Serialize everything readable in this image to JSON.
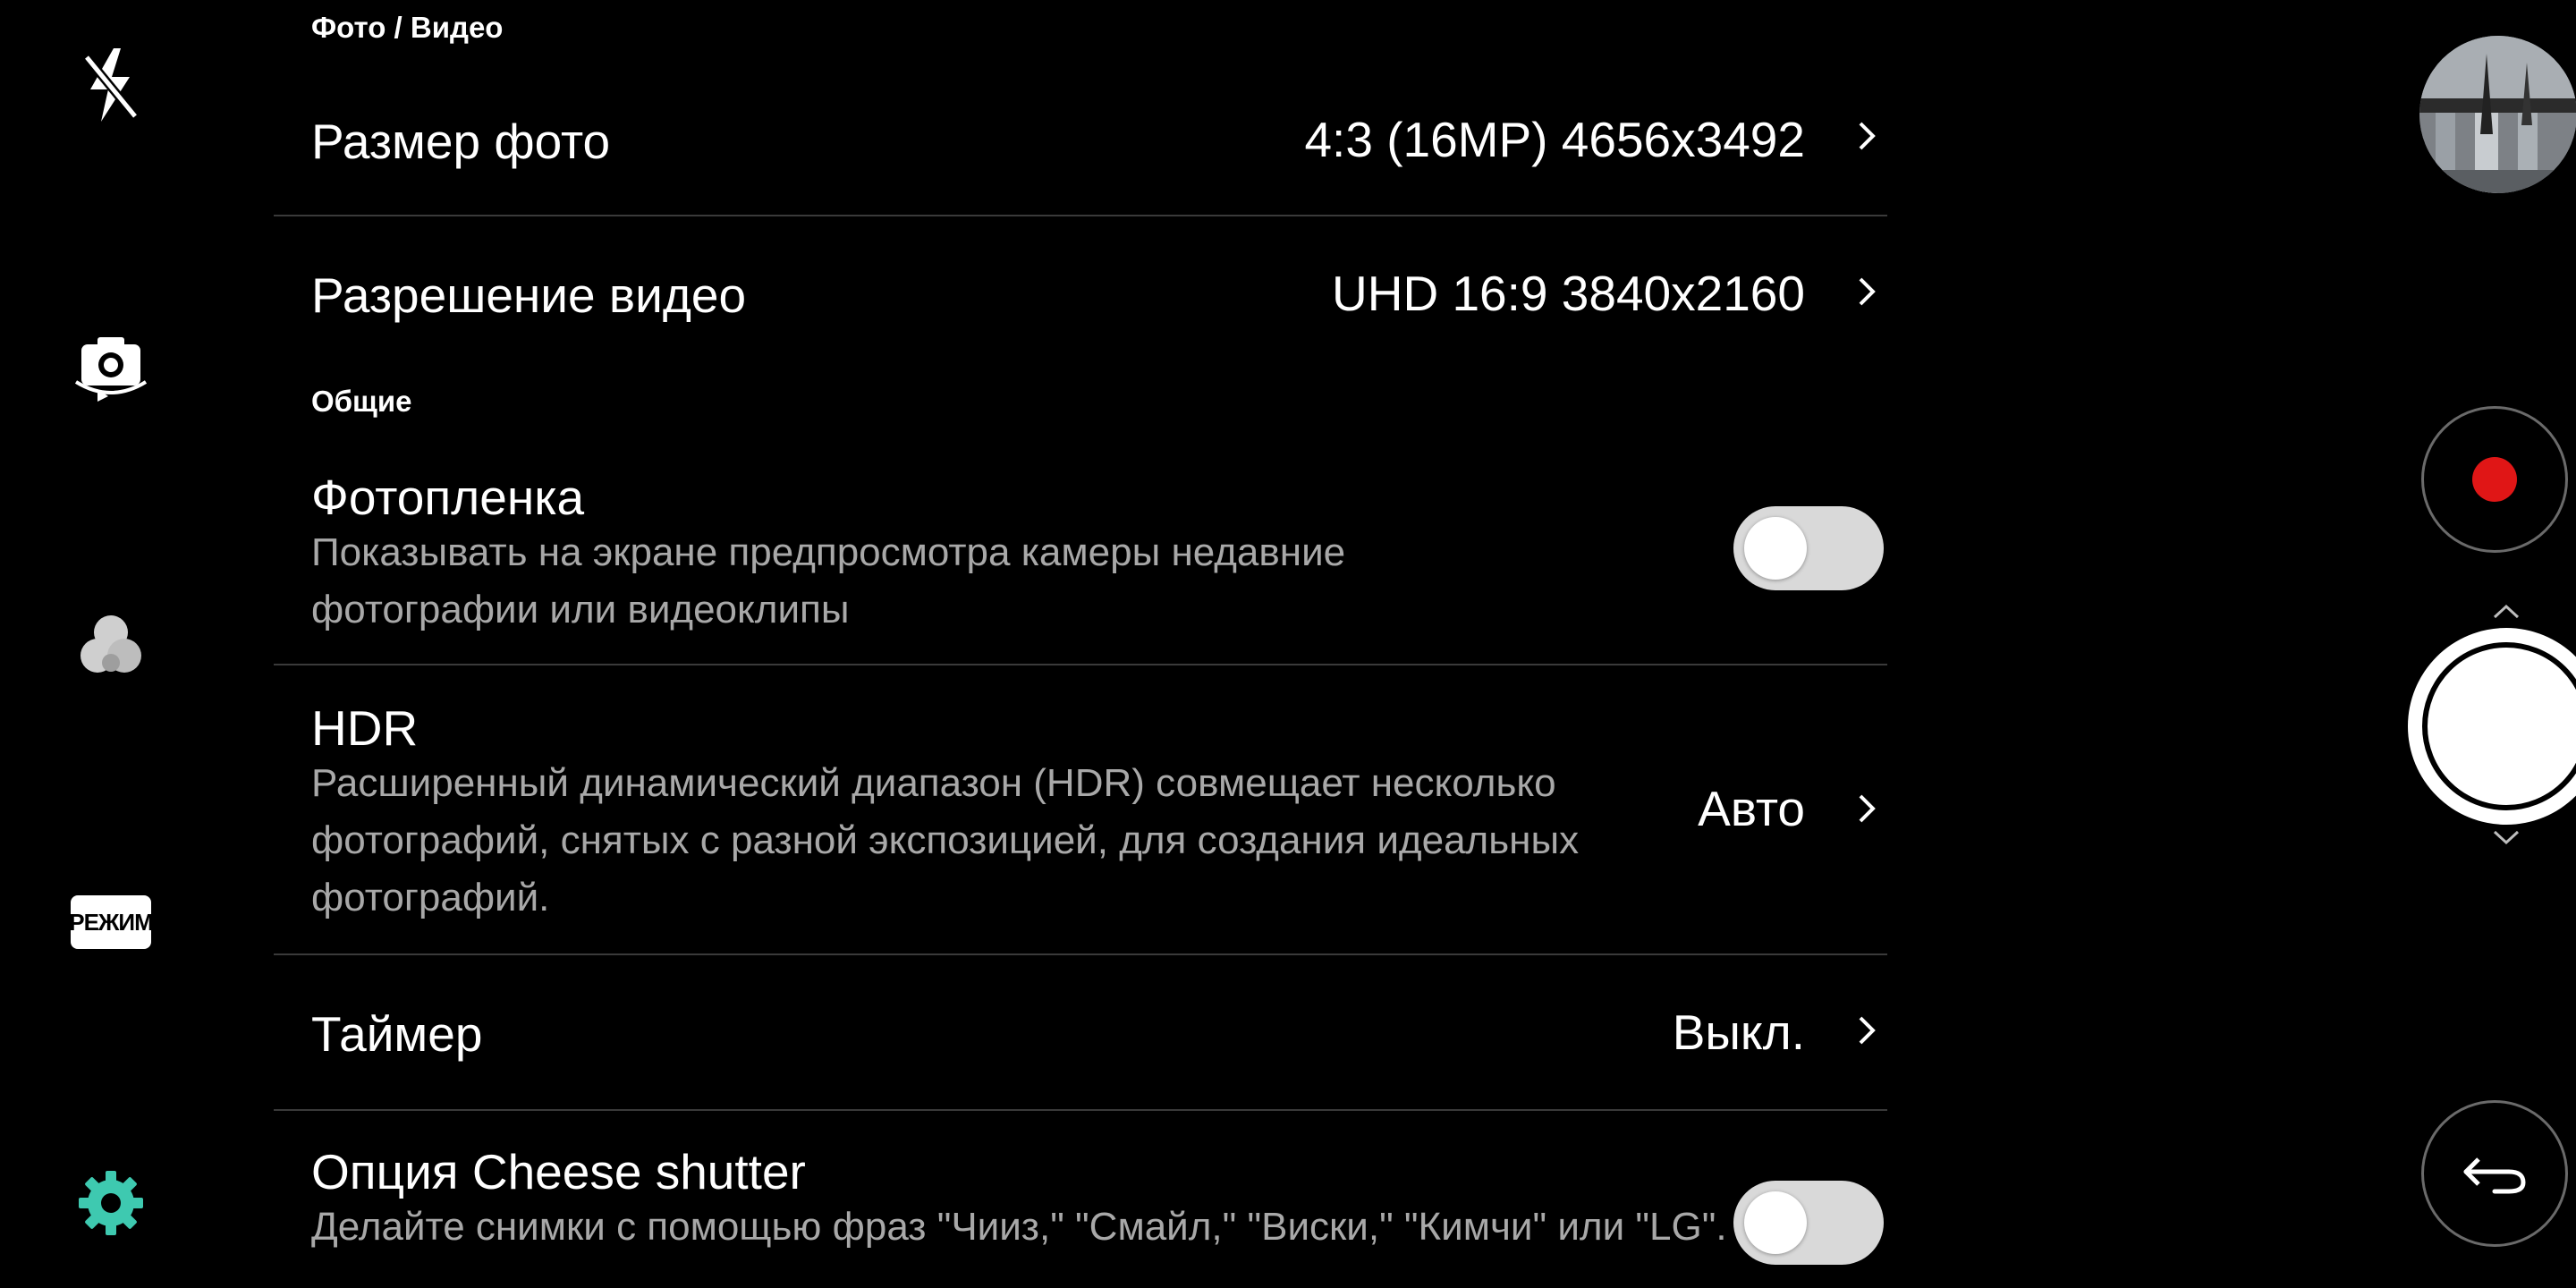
{
  "left_toolbar": {
    "flash_icon": "flash-off-icon",
    "switch_camera_icon": "camera-switch-icon",
    "filter_icon": "filter-icon",
    "mode_label": "РЕЖИМ",
    "settings_icon": "gear-icon",
    "settings_color": "#3ec9b0"
  },
  "settings": {
    "sections": [
      {
        "title": "Фото / Видео",
        "rows": [
          {
            "title": "Размер фото",
            "value": "4:3 (16MP) 4656x3492"
          },
          {
            "title": "Разрешение видео",
            "value": "UHD 16:9 3840x2160"
          }
        ]
      },
      {
        "title": "Общие",
        "rows": [
          {
            "title": "Фотопленка",
            "description": "Показывать на экране предпросмотра камеры недавние фотографии или видеоклипы",
            "toggle": "off"
          },
          {
            "title": "HDR",
            "description": "Расширенный динамический диапазон (HDR) совмещает несколько фотографий, снятых с разной экспозицией, для создания идеальных фотографий.",
            "value": "Авто"
          },
          {
            "title": "Таймер",
            "value": "Выкл."
          },
          {
            "title": "Опция Cheese shutter",
            "description": "Делайте снимки с помощью фраз \"Чииз,\" \"Смайл,\" \"Виски,\" \"Кимчи\" или \"LG\".",
            "toggle": "off"
          }
        ]
      }
    ]
  },
  "right_bar": {
    "gallery_icon": "gallery-thumbnail",
    "record_icon": "record-icon",
    "record_color": "#e01616",
    "shutter_icon": "shutter-button",
    "back_icon": "back-arrow-icon"
  }
}
